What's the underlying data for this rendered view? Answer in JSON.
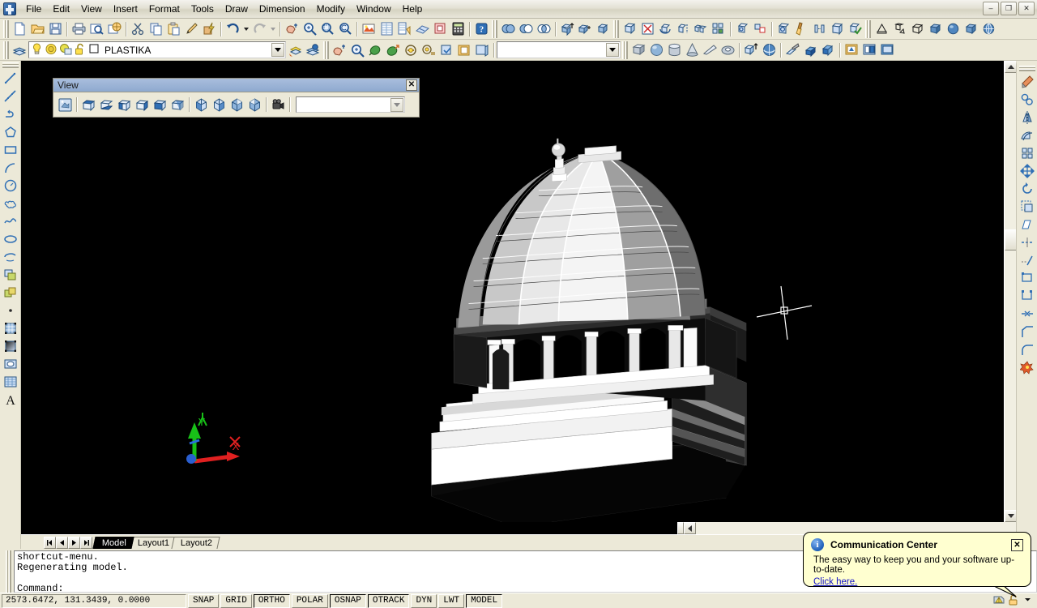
{
  "window": {
    "minimize_label": "–",
    "restore_label": "❐",
    "close_label": "✕"
  },
  "menubar": {
    "items": [
      {
        "label": "File"
      },
      {
        "label": "Edit"
      },
      {
        "label": "View"
      },
      {
        "label": "Insert"
      },
      {
        "label": "Format"
      },
      {
        "label": "Tools"
      },
      {
        "label": "Draw"
      },
      {
        "label": "Dimension"
      },
      {
        "label": "Modify"
      },
      {
        "label": "Window"
      },
      {
        "label": "Help"
      }
    ]
  },
  "toolbars": {
    "standard": [
      "new-icon",
      "open-icon",
      "save-icon",
      "plot-icon",
      "plot-preview-icon",
      "publish-icon",
      "cut-icon",
      "copy-icon",
      "paste-icon",
      "match-properties-icon",
      "properties-update-icon",
      "undo-icon",
      "redo-icon",
      "pan-realtime-icon",
      "zoom-realtime-icon",
      "zoom-window-icon",
      "zoom-previous-icon",
      "render-icon",
      "properties-icon",
      "design-center-icon",
      "tool-palettes-icon",
      "sheet-set-icon",
      "markup-set-icon",
      "calculator-icon",
      "help-icon"
    ],
    "layers": {
      "layers_icon": "layers-icon",
      "bulb_icon": "lightbulb-on-icon",
      "sun_icon": "freeze-sun-icon",
      "lock_icon": "unlocked-icon",
      "color_swatch": "layer-color-swatch",
      "current_layer": "PLASTIKA",
      "make_current_icon": "make-object-layer-current-icon",
      "layer_previous_icon": "layer-previous-icon"
    },
    "properties_combo_value": "",
    "solids": [
      "box-icon",
      "sphere-icon",
      "cylinder-icon",
      "cone-icon",
      "wedge-icon",
      "torus-icon",
      "extrude-icon",
      "revolve-icon",
      "slice-icon",
      "section-icon",
      "interfere-icon",
      "setup-drawing-icon",
      "setup-view-icon",
      "setup-profile-icon"
    ],
    "modify2": [
      "union-icon",
      "subtract-icon",
      "intersect-icon",
      "extrude-face-icon",
      "move-face-icon",
      "copy-object-icon",
      "3d-array-icon",
      "3d-mirror-icon",
      "3d-rotate-icon",
      "align-icon",
      "3d-align-icon",
      "imprint-icon",
      "clean-icon",
      "separate-icon",
      "shell-icon",
      "check-icon",
      "cone-solid-icon",
      "pyramid-icon",
      "wireframe-box-icon",
      "shaded-box-icon",
      "sphere-shade-icon",
      "hidden-box-icon",
      "gouraud-sphere-icon"
    ]
  },
  "view_toolbar": {
    "title": "View",
    "close_label": "✕",
    "buttons": [
      "named-views-icon",
      "top-view-icon",
      "bottom-view-icon",
      "left-view-icon",
      "right-view-icon",
      "front-view-icon",
      "back-view-icon",
      "sw-isometric-icon",
      "se-isometric-icon",
      "ne-isometric-icon",
      "nw-isometric-icon",
      "camera-icon"
    ],
    "combo_value": ""
  },
  "left_toolbar": {
    "items": [
      "line-icon",
      "construction-line-icon",
      "polyline-icon",
      "polygon-icon",
      "rectangle-icon",
      "arc-icon",
      "circle-icon",
      "revision-cloud-icon",
      "spline-icon",
      "ellipse-icon",
      "ellipse-arc-icon",
      "insert-block-icon",
      "make-block-icon",
      "point-icon",
      "hatch-icon",
      "gradient-icon",
      "region-icon",
      "table-icon",
      "multiline-text-icon"
    ]
  },
  "right_toolbar": {
    "items": [
      "erase-icon",
      "copy-icon",
      "mirror-icon",
      "offset-icon",
      "array-icon",
      "move-icon",
      "rotate-icon",
      "scale-icon",
      "stretch-icon",
      "trim-icon",
      "extend-icon",
      "break-at-point-icon",
      "break-icon",
      "join-icon",
      "chamfer-icon",
      "fillet-icon",
      "explode-icon"
    ]
  },
  "tabs": {
    "nav": [
      "first-tab-icon",
      "prev-tab-icon",
      "next-tab-icon",
      "last-tab-icon"
    ],
    "items": [
      {
        "label": "Model",
        "active": true
      },
      {
        "label": "Layout1",
        "active": false
      },
      {
        "label": "Layout2",
        "active": false
      }
    ]
  },
  "command_window": {
    "lines": [
      "shortcut-menu.",
      "Regenerating model.",
      "",
      "Command:"
    ]
  },
  "status_bar": {
    "coordinates": "2573.6472, 131.3439, 0.0000",
    "toggles": [
      {
        "label": "SNAP",
        "pressed": false
      },
      {
        "label": "GRID",
        "pressed": false
      },
      {
        "label": "ORTHO",
        "pressed": true
      },
      {
        "label": "POLAR",
        "pressed": false
      },
      {
        "label": "OSNAP",
        "pressed": true
      },
      {
        "label": "OTRACK",
        "pressed": true
      },
      {
        "label": "DYN",
        "pressed": false
      },
      {
        "label": "LWT",
        "pressed": false
      },
      {
        "label": "MODEL",
        "pressed": true
      }
    ],
    "tray": [
      "communication-center-icon",
      "manage-xrefs-icon",
      "tray-expand-icon"
    ]
  },
  "balloon": {
    "icon": "info-icon",
    "icon_glyph": "i",
    "title": "Communication Center",
    "message": "The easy way to keep you and your software up-to-date.",
    "link": "Click here.",
    "close_label": "✕"
  },
  "drawing": {
    "ucs": {
      "x_label": "X",
      "y_label": "Y"
    },
    "model_name": "dome-cupola-3d-model",
    "background_color": "#000000",
    "crosshair": "crosshair-cursor"
  }
}
